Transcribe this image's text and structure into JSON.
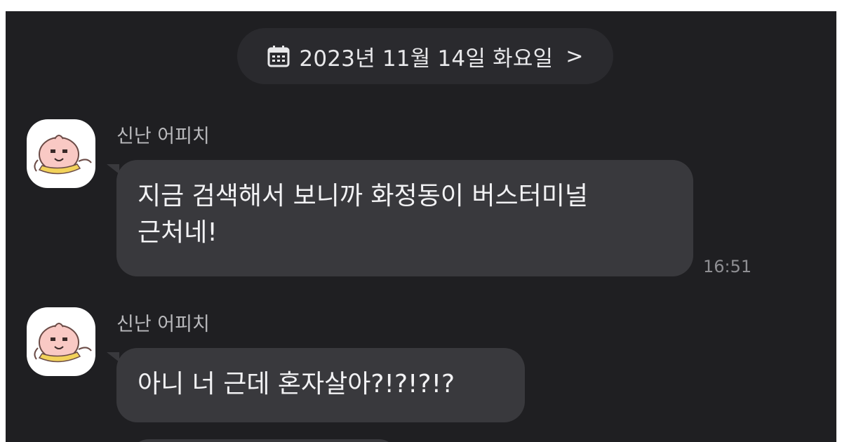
{
  "date_header": {
    "label": "2023년 11월 14일 화요일",
    "chevron": ">",
    "icon": "calendar-icon"
  },
  "messages": [
    {
      "sender": "신난 어피치",
      "avatar": "apeach-avatar",
      "lines": [
        "지금 검색해서 보니까 화정동이 버스터미널",
        "근처네!"
      ],
      "time": "16:51"
    },
    {
      "sender": "신난 어피치",
      "avatar": "apeach-avatar",
      "lines": [
        "아니 너 근데 혼자살아?!?!?!?"
      ],
      "time": ""
    }
  ],
  "colors": {
    "background": "#1f1f22",
    "bubble": "#39393d",
    "date_pill": "#2a2a2e",
    "text": "#f2f2f4",
    "meta": "#8f8f93"
  }
}
